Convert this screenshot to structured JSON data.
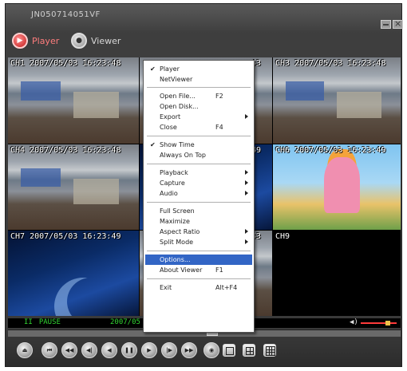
{
  "window": {
    "title": "JN050714051VF"
  },
  "modes": {
    "player_label": "Player",
    "viewer_label": "Viewer"
  },
  "channels": [
    {
      "label": "CH1 2007/05/03 16:23:48"
    },
    {
      "label": "43"
    },
    {
      "label": "CH3 2007/05/03 16:23:48"
    },
    {
      "label": "CH4 2007/05/03 16:23:48"
    },
    {
      "label": "49"
    },
    {
      "label": "CH6 2007/05/03 16:23:49"
    },
    {
      "label": "CH7 2007/05/03 16:23:49"
    },
    {
      "label": "43"
    },
    {
      "label": "CH9"
    }
  ],
  "context_menu": {
    "items": [
      {
        "label": "Player",
        "checked": true
      },
      {
        "label": "NetViewer"
      },
      {
        "label": "Open File...",
        "shortcut": "F2"
      },
      {
        "label": "Open Disk..."
      },
      {
        "label": "Export",
        "submenu": true
      },
      {
        "label": "Close",
        "shortcut": "F4"
      },
      {
        "label": "Show Time",
        "checked": true
      },
      {
        "label": "Always On Top"
      },
      {
        "label": "Playback",
        "submenu": true
      },
      {
        "label": "Capture",
        "submenu": true
      },
      {
        "label": "Audio",
        "submenu": true
      },
      {
        "label": "Full Screen"
      },
      {
        "label": "Maximize"
      },
      {
        "label": "Aspect Ratio",
        "submenu": true
      },
      {
        "label": "Split Mode",
        "submenu": true
      },
      {
        "label": "Options...",
        "highlighted": true
      },
      {
        "label": "About Viewer",
        "shortcut": "F1"
      },
      {
        "label": "Exit",
        "shortcut": "Alt+F4"
      }
    ]
  },
  "status": {
    "pause_icon": "II",
    "state": "PAUSE",
    "date": "2007/05"
  },
  "playback": {
    "seek_position": 0.52,
    "volume_level": 0.8
  },
  "colors": {
    "status_text": "#31d431",
    "menu_highlight": "#3265c5",
    "player_accent": "#ff7d7d"
  }
}
